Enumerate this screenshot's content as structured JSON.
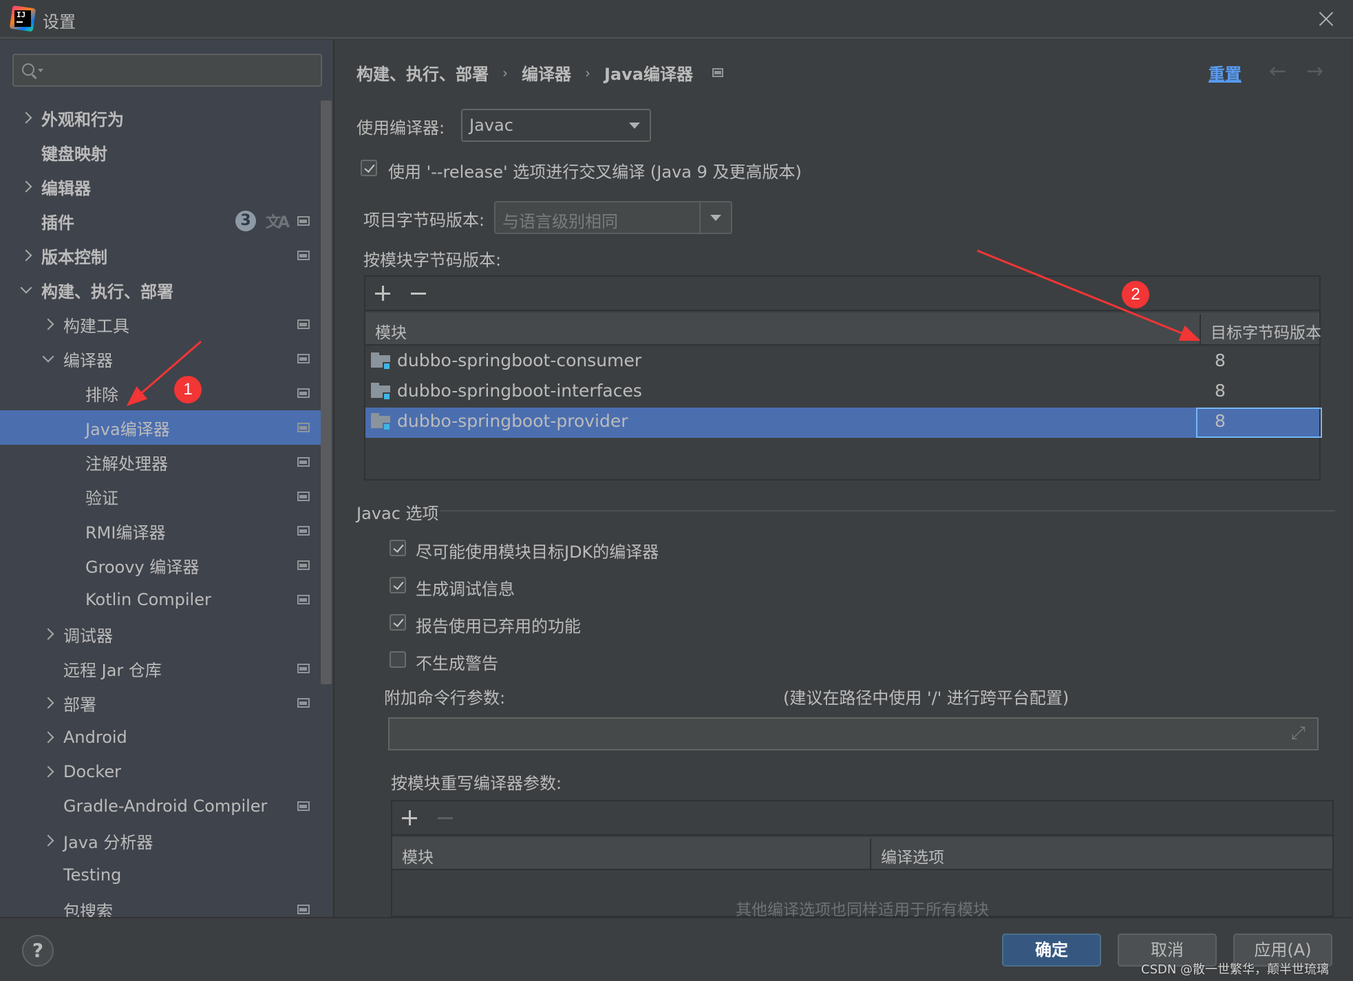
{
  "window": {
    "title": "设置",
    "app_icon": "intellij-idea-logo"
  },
  "sidebar": {
    "search": {
      "placeholder": "",
      "value": ""
    },
    "items": [
      {
        "label": "外观和行为",
        "level": 0,
        "bold": true,
        "expand": "collapsed",
        "project_icon": false
      },
      {
        "label": "键盘映射",
        "level": 0,
        "bold": true,
        "expand": "none",
        "project_icon": false
      },
      {
        "label": "编辑器",
        "level": 0,
        "bold": true,
        "expand": "collapsed",
        "project_icon": false
      },
      {
        "label": "插件",
        "level": 0,
        "bold": true,
        "expand": "none",
        "project_icon": true,
        "badge": "3",
        "translate_icon": "文A"
      },
      {
        "label": "版本控制",
        "level": 0,
        "bold": true,
        "expand": "collapsed",
        "project_icon": true
      },
      {
        "label": "构建、执行、部署",
        "level": 0,
        "bold": true,
        "expand": "expanded",
        "project_icon": false
      },
      {
        "label": "构建工具",
        "level": 1,
        "bold": false,
        "expand": "collapsed",
        "project_icon": true
      },
      {
        "label": "编译器",
        "level": 1,
        "bold": false,
        "expand": "expanded",
        "project_icon": true
      },
      {
        "label": "排除",
        "level": 2,
        "bold": false,
        "expand": "none",
        "project_icon": true
      },
      {
        "label": "Java编译器",
        "level": 2,
        "bold": false,
        "expand": "none",
        "project_icon": true,
        "selected": true
      },
      {
        "label": "注解处理器",
        "level": 2,
        "bold": false,
        "expand": "none",
        "project_icon": true
      },
      {
        "label": "验证",
        "level": 2,
        "bold": false,
        "expand": "none",
        "project_icon": true
      },
      {
        "label": "RMI编译器",
        "level": 2,
        "bold": false,
        "expand": "none",
        "project_icon": true
      },
      {
        "label": "Groovy 编译器",
        "level": 2,
        "bold": false,
        "expand": "none",
        "project_icon": true
      },
      {
        "label": "Kotlin Compiler",
        "level": 2,
        "bold": false,
        "expand": "none",
        "project_icon": true
      },
      {
        "label": "调试器",
        "level": 1,
        "bold": false,
        "expand": "collapsed",
        "project_icon": false
      },
      {
        "label": "远程 Jar 仓库",
        "level": 1,
        "bold": false,
        "expand": "none",
        "project_icon": true
      },
      {
        "label": "部署",
        "level": 1,
        "bold": false,
        "expand": "collapsed",
        "project_icon": true
      },
      {
        "label": "Android",
        "level": 1,
        "bold": false,
        "expand": "collapsed",
        "project_icon": false
      },
      {
        "label": "Docker",
        "level": 1,
        "bold": false,
        "expand": "collapsed",
        "project_icon": false
      },
      {
        "label": "Gradle-Android Compiler",
        "level": 1,
        "bold": false,
        "expand": "none",
        "project_icon": true
      },
      {
        "label": "Java 分析器",
        "level": 1,
        "bold": false,
        "expand": "collapsed",
        "project_icon": false
      },
      {
        "label": "Testing",
        "level": 1,
        "bold": false,
        "expand": "none",
        "project_icon": false
      },
      {
        "label": "包搜索",
        "level": 1,
        "bold": false,
        "expand": "none",
        "project_icon": true
      }
    ]
  },
  "header": {
    "breadcrumb": [
      "构建、执行、部署",
      "编译器",
      "Java编译器"
    ],
    "reset_label": "重置",
    "back_icon": "←",
    "forward_icon": "→"
  },
  "compiler": {
    "label": "使用编译器:",
    "value": "Javac"
  },
  "release_option": {
    "checked": true,
    "label": "使用 '--release' 选项进行交叉编译 (Java 9 及更高版本)"
  },
  "project_bytecode": {
    "label": "项目字节码版本:",
    "value": "与语言级别相同",
    "disabled": true
  },
  "per_module_bytecode": {
    "label": "按模块字节码版本:",
    "columns": [
      "模块",
      "目标字节码版本"
    ],
    "rows": [
      {
        "module": "dubbo-springboot-consumer",
        "version": "8",
        "selected": false
      },
      {
        "module": "dubbo-springboot-interfaces",
        "version": "8",
        "selected": false
      },
      {
        "module": "dubbo-springboot-provider",
        "version": "8",
        "selected": true
      }
    ]
  },
  "javac_options": {
    "section_title": "Javac 选项",
    "checkboxes": [
      {
        "label": "尽可能使用模块目标JDK的编译器",
        "checked": true
      },
      {
        "label": "生成调试信息",
        "checked": true
      },
      {
        "label": "报告使用已弃用的功能",
        "checked": true
      },
      {
        "label": "不生成警告",
        "checked": false
      }
    ],
    "cmdline_label": "附加命令行参数:",
    "cmdline_hint": "(建议在路径中使用 '/' 进行跨平台配置)",
    "cmdline_value": ""
  },
  "override_params": {
    "label": "按模块重写编译器参数:",
    "columns": [
      "模块",
      "编译选项"
    ],
    "empty_text": "其他编译选项也同样适用于所有模块"
  },
  "footer": {
    "help_label": "?",
    "ok_label": "确定",
    "cancel_label": "取消",
    "apply_label": "应用(A)",
    "watermark": "CSDN @散一世繁华，颠半世琉璃"
  },
  "annotations": [
    {
      "number": "1",
      "color": "#f23535"
    },
    {
      "number": "2",
      "color": "#f23535"
    }
  ]
}
